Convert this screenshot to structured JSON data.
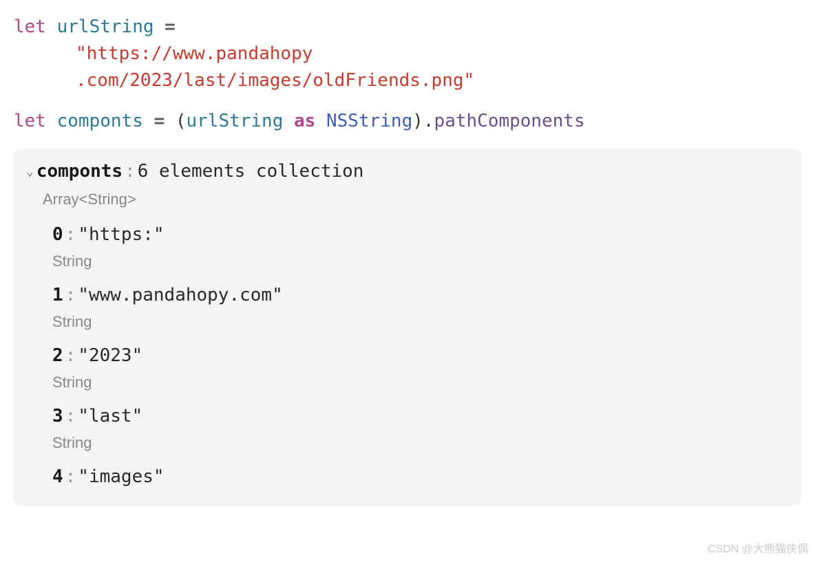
{
  "code": {
    "line1": {
      "let": "let",
      "var": "urlString",
      "eq": "="
    },
    "line2": "\"https://www.pandahopy",
    "line3": ".com/2023/last/images/oldFriends.png\"",
    "line4": {
      "let": "let",
      "var": "componts",
      "eq": "=",
      "op1": "(",
      "castVar": "urlString",
      "asKw": "as",
      "type": "NSString",
      "op2": ").",
      "method": "pathComponents"
    }
  },
  "result": {
    "name": "componts",
    "desc": "6 elements collection",
    "typeLabel": "Array<String>",
    "items": [
      {
        "idx": "0",
        "value": "\"https:\"",
        "type": "String"
      },
      {
        "idx": "1",
        "value": "\"www.pandahopy.com\"",
        "type": "String"
      },
      {
        "idx": "2",
        "value": "\"2023\"",
        "type": "String"
      },
      {
        "idx": "3",
        "value": "\"last\"",
        "type": "String"
      },
      {
        "idx": "4",
        "value": "\"images\"",
        "type": null
      }
    ]
  },
  "watermark": "CSDN @大熊猫侠偶"
}
